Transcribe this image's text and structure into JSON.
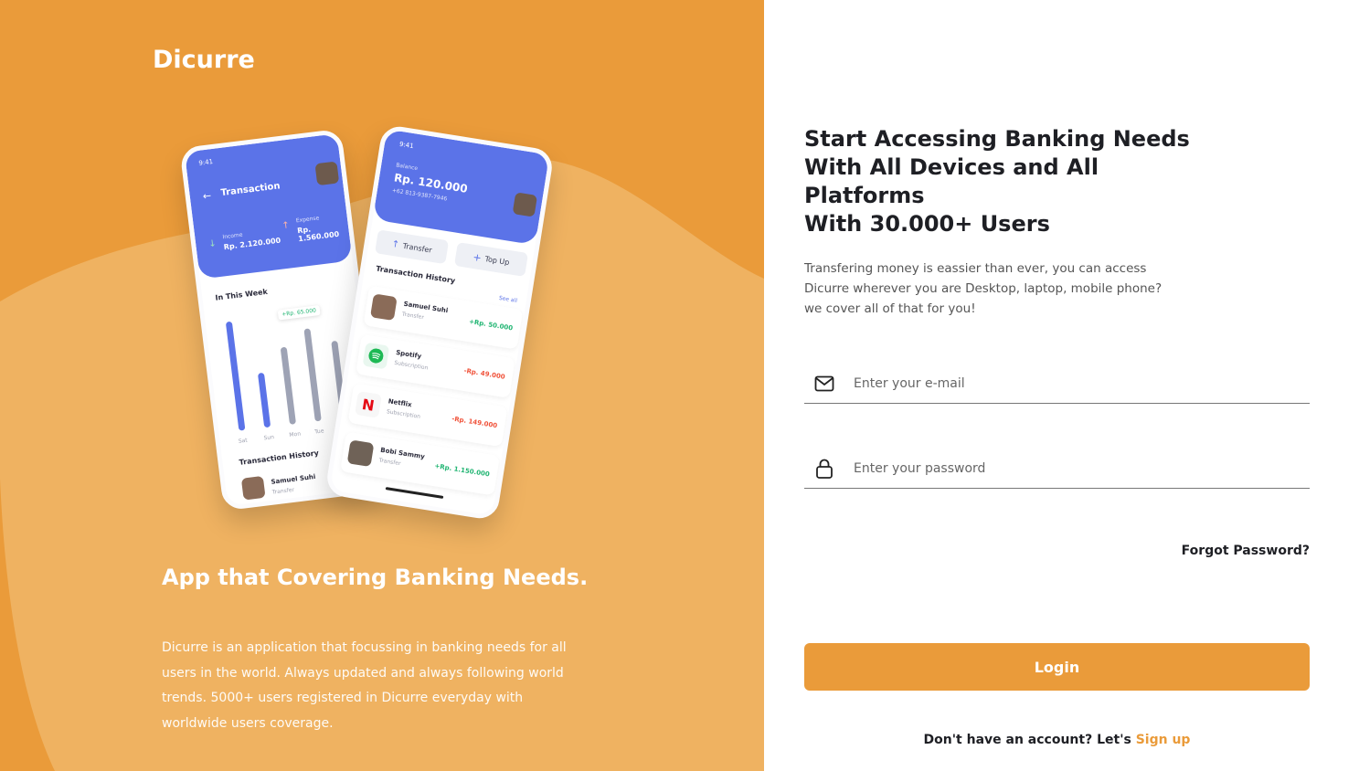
{
  "brand": "Dicurre",
  "left": {
    "tagline": "App that Covering Banking Needs.",
    "description": "Dicurre is an application that focussing in banking needs for all users in the world. Always updated and always following world trends. 5000+ users registered in Dicurre everyday with worldwide users coverage.",
    "phone1": {
      "time": "9:41",
      "title": "Transaction",
      "income_label": "Income",
      "income_value": "Rp. 2.120.000",
      "expense_label": "Expense",
      "expense_value": "Rp. 1.560.000",
      "week_label": "In This Week",
      "tooltip": "+Rp. 65.000",
      "days": [
        "Sat",
        "Sun",
        "Mon",
        "Tue"
      ],
      "history_label": "Transaction History",
      "row_name": "Samuel Suhi",
      "row_type": "Transfer"
    },
    "phone2": {
      "time": "9:41",
      "balance_label": "Balance",
      "balance_value": "Rp. 120.000",
      "account": "+62 813-9387-7946",
      "transfer_label": "Transfer",
      "topup_label": "Top Up",
      "history_label": "Transaction History",
      "see_all": "See all",
      "transactions": [
        {
          "name": "Samuel Suhi",
          "type": "Transfer",
          "amount": "+Rp. 50.000"
        },
        {
          "name": "Spotify",
          "type": "Subscription",
          "amount": "-Rp. 49.000"
        },
        {
          "name": "Netflix",
          "type": "Subscription",
          "amount": "-Rp. 149.000"
        },
        {
          "name": "Bobi Sammy",
          "type": "Transfer",
          "amount": "+Rp. 1.150.000"
        }
      ]
    }
  },
  "right": {
    "headline_1": "Start Accessing Banking Needs",
    "headline_2": "With All Devices and All Platforms",
    "headline_3": "With 30.000+ Users",
    "subtext_1": "Transfering money is eassier than ever, you can access",
    "subtext_2": "Dicurre wherever you are Desktop, laptop, mobile phone?",
    "subtext_3": "we cover all of that for you!",
    "email_placeholder": "Enter your e-mail",
    "password_placeholder": "Enter your password",
    "forgot_password": "Forgot Password?",
    "login_button": "Login",
    "signup_prompt": "Don't have an account? Let's",
    "signup_link": "Sign up"
  },
  "colors": {
    "accent": "#EA9B3A",
    "phone_blue": "#5B73E8",
    "positive": "#22b573",
    "negative": "#f0533b"
  }
}
